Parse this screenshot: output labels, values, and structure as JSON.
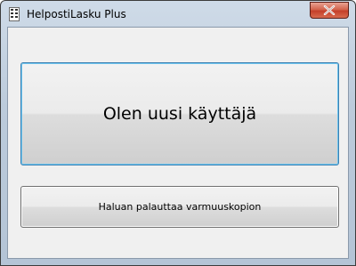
{
  "window": {
    "title": "HelpostiLasku Plus",
    "app_icon": "document-app-icon",
    "close_icon": "close-icon"
  },
  "buttons": {
    "new_user_label": "Olen uusi käyttäjä",
    "restore_backup_label": "Haluan palauttaa varmuuskopion"
  },
  "colors": {
    "close_button": "#c7432e",
    "focused_button_border": "#3c7fb1",
    "client_background": "#f0f0f0"
  }
}
